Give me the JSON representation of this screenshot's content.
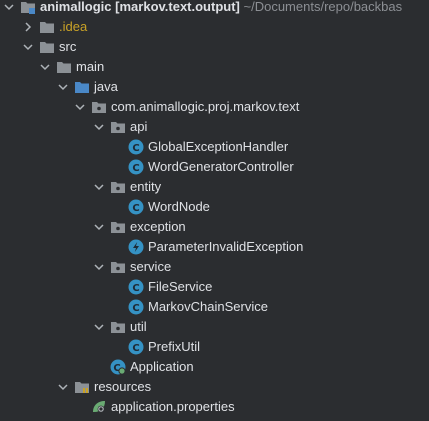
{
  "tree": {
    "root": {
      "name": "animallogic",
      "module": "[markov.text.output]",
      "path": "~/Documents/repo/backbas"
    },
    "nodes": [
      {
        "label": ".idea"
      },
      {
        "label": "src"
      },
      {
        "label": "main"
      },
      {
        "label": "java"
      },
      {
        "label": "com.animallogic.proj.markov.text"
      },
      {
        "label": "api"
      },
      {
        "label": "GlobalExceptionHandler"
      },
      {
        "label": "WordGeneratorController"
      },
      {
        "label": "entity"
      },
      {
        "label": "WordNode"
      },
      {
        "label": "exception"
      },
      {
        "label": "ParameterInvalidException"
      },
      {
        "label": "service"
      },
      {
        "label": "FileService"
      },
      {
        "label": "MarkovChainService"
      },
      {
        "label": "util"
      },
      {
        "label": "PrefixUtil"
      },
      {
        "label": "Application"
      },
      {
        "label": "resources"
      },
      {
        "label": "application.properties"
      }
    ]
  },
  "colors": {
    "background": "#2b2d30",
    "text": "#dfe1e5",
    "muted": "#8c8f94",
    "folder": "#8c9196",
    "source_folder": "#4a88c7",
    "class_icon": "#3592c4",
    "excluded": "#c9a227"
  }
}
